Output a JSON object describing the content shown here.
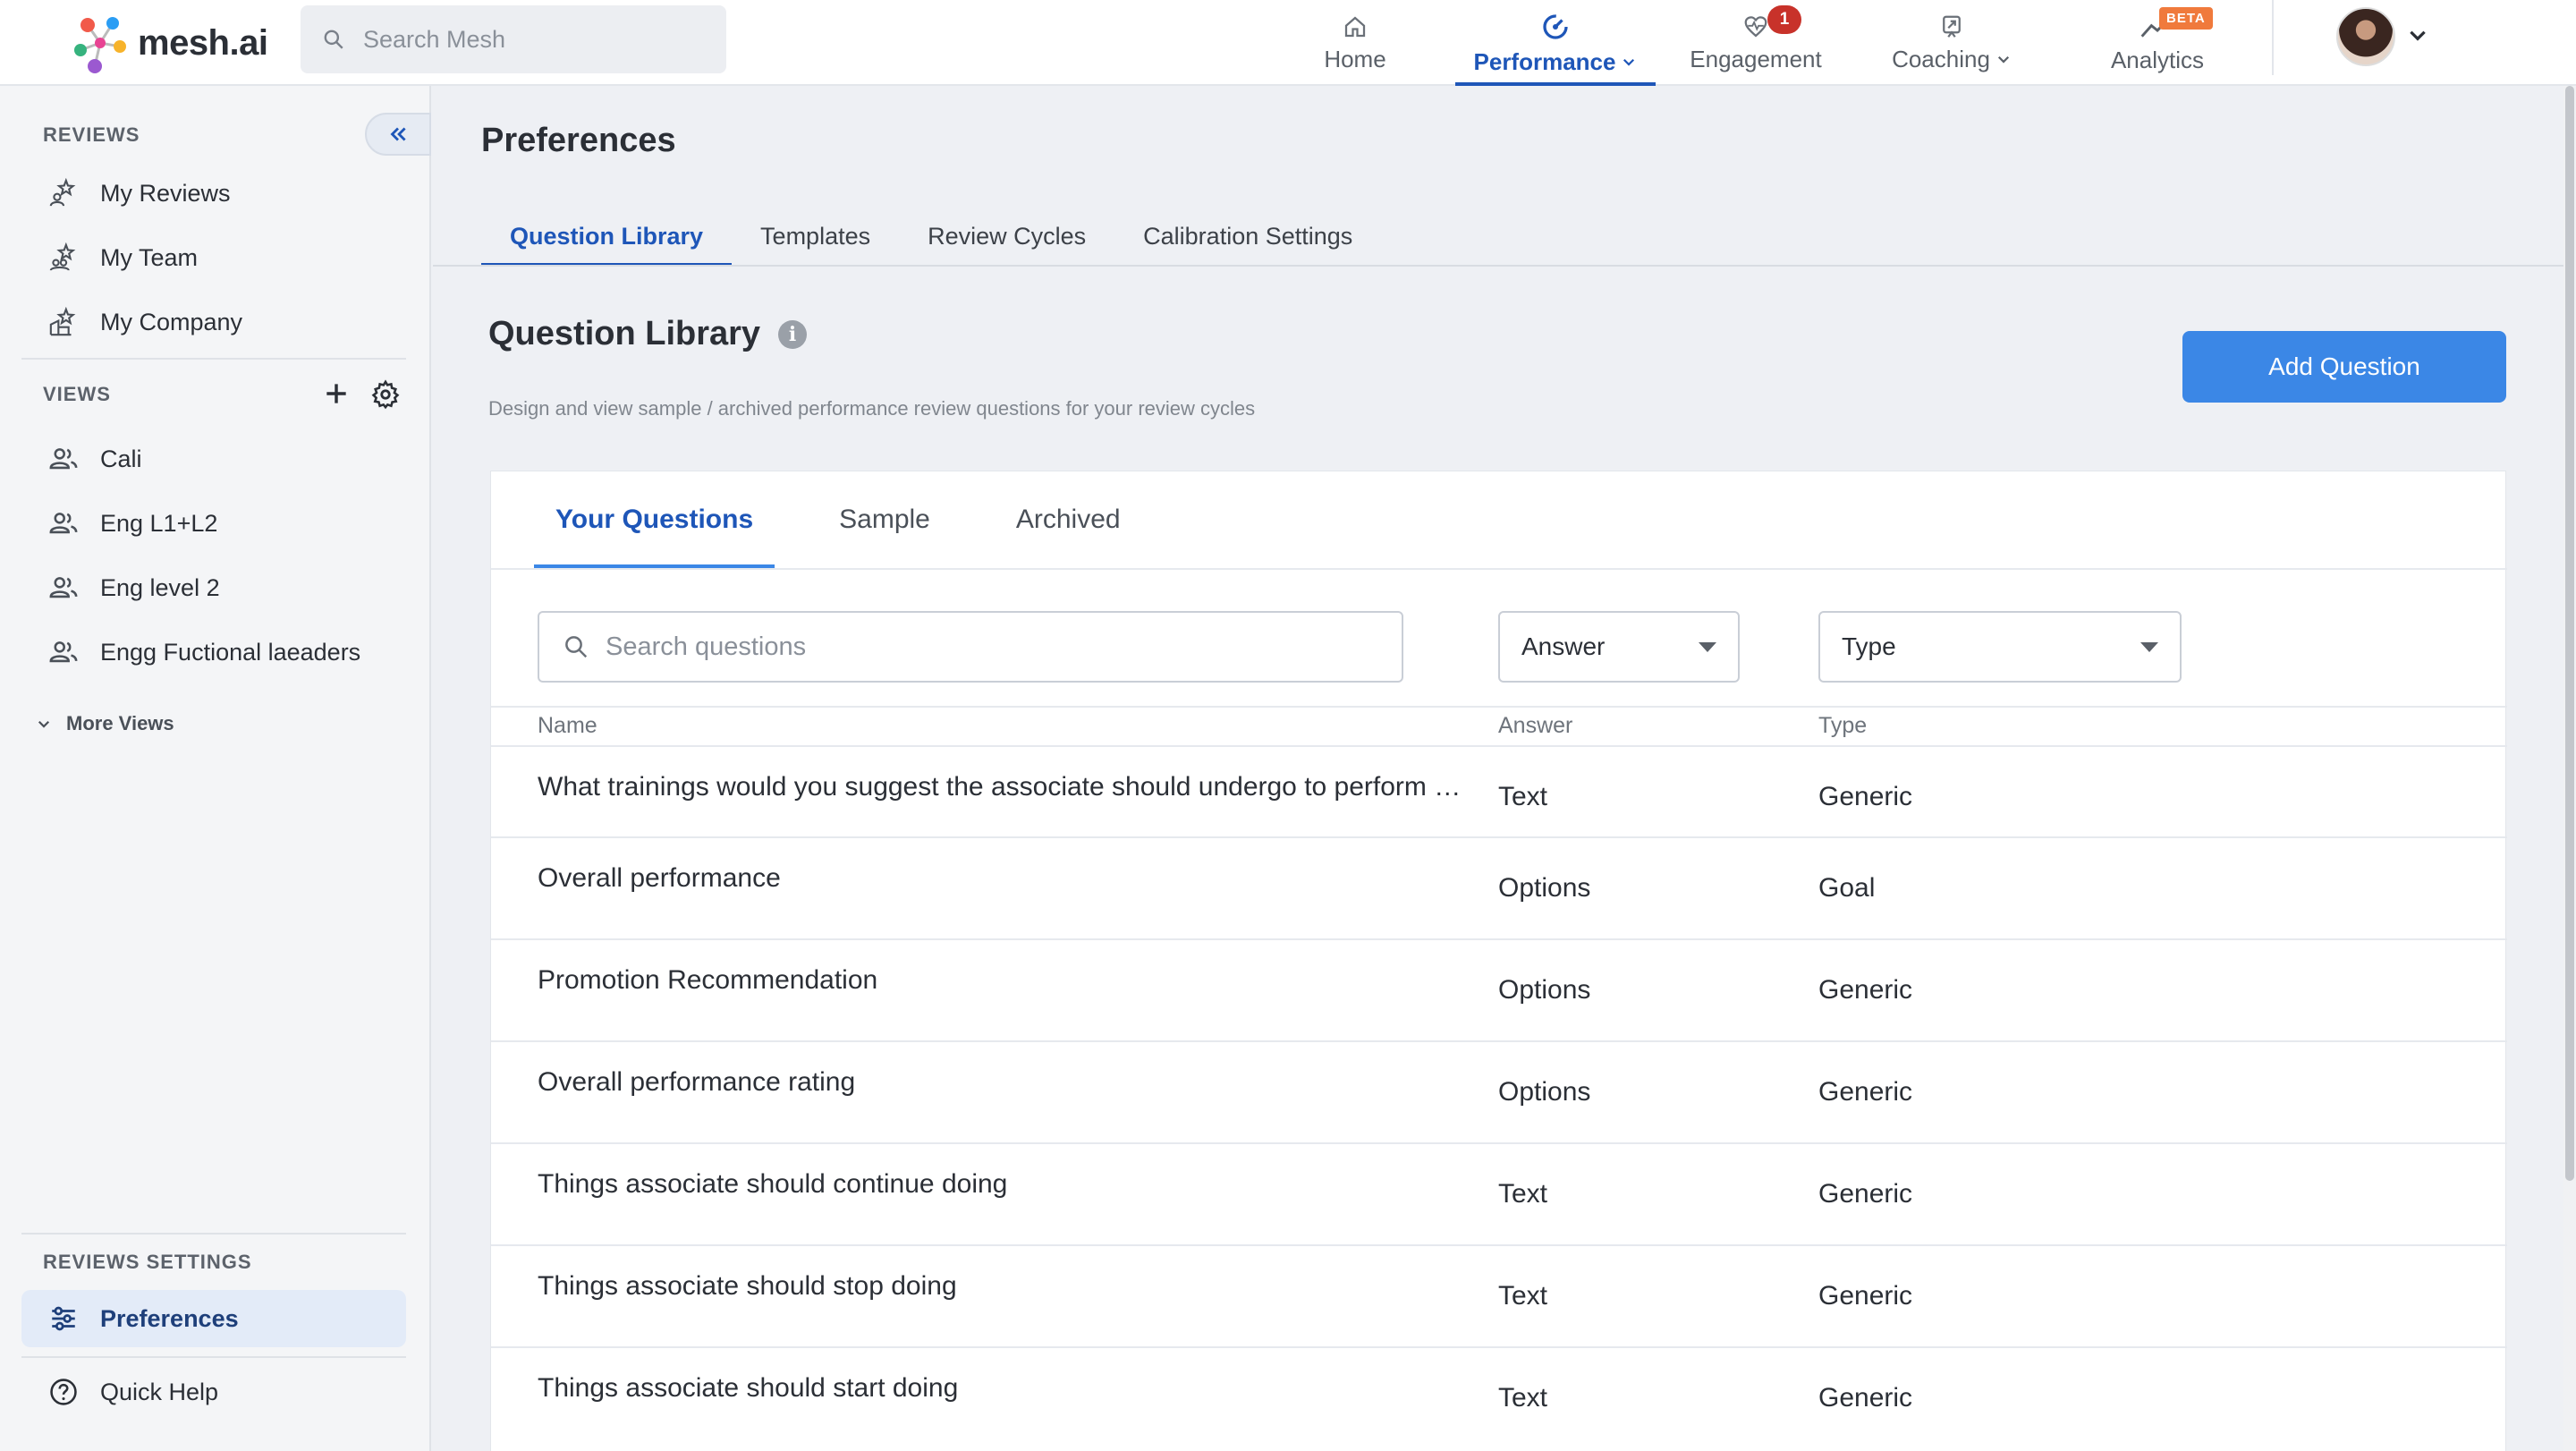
{
  "brand": {
    "logo_text": "mesh.ai"
  },
  "top_search": {
    "placeholder": "Search Mesh"
  },
  "nav": {
    "home": "Home",
    "performance": "Performance",
    "engagement": "Engagement",
    "engagement_badge": "1",
    "coaching": "Coaching",
    "analytics": "Analytics",
    "analytics_badge": "BETA"
  },
  "sidebar": {
    "reviews_label": "REVIEWS",
    "reviews_items": [
      "My Reviews",
      "My Team",
      "My Company"
    ],
    "views_label": "VIEWS",
    "views_items": [
      "Cali",
      "Eng L1+L2",
      "Eng level 2",
      "Engg Fuctional laeaders"
    ],
    "more_views": "More Views",
    "settings_label": "REVIEWS SETTINGS",
    "preferences": "Preferences",
    "quick_help": "Quick Help"
  },
  "page": {
    "title": "Preferences",
    "tabs": [
      "Question Library",
      "Templates",
      "Review Cycles",
      "Calibration Settings"
    ]
  },
  "library": {
    "title": "Question Library",
    "info": "i",
    "description": "Design and view sample / archived performance review questions for your review cycles",
    "add_button": "Add Question",
    "tabs": [
      "Your Questions",
      "Sample",
      "Archived"
    ],
    "search_placeholder": "Search questions",
    "answer_filter": "Answer",
    "type_filter": "Type",
    "columns": {
      "name": "Name",
      "answer": "Answer",
      "type": "Type"
    },
    "rows": [
      {
        "name": "What trainings would you suggest the associate should undergo to perform better in the future?",
        "answer": "Text",
        "type": "Generic"
      },
      {
        "name": "Overall performance",
        "answer": "Options",
        "type": "Goal"
      },
      {
        "name": "Promotion Recommendation",
        "answer": "Options",
        "type": "Generic"
      },
      {
        "name": "Overall performance rating",
        "answer": "Options",
        "type": "Generic"
      },
      {
        "name": "Things associate should continue doing",
        "answer": "Text",
        "type": "Generic"
      },
      {
        "name": "Things associate should stop doing",
        "answer": "Text",
        "type": "Generic"
      },
      {
        "name": "Things associate should start doing",
        "answer": "Text",
        "type": "Generic"
      }
    ]
  },
  "colors": {
    "accent": "#1e56b8",
    "button": "#3b87e6",
    "badge": "#c8322a",
    "beta": "#f07a3c"
  }
}
